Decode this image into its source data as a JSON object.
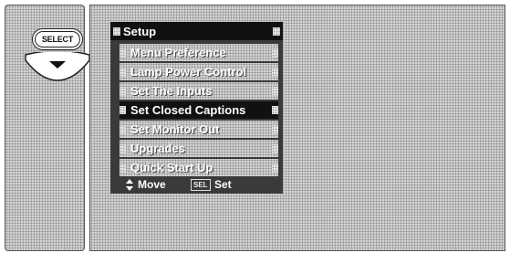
{
  "remote": {
    "select_label": "SELECT",
    "select_icon": "select-button-icon",
    "down_icon": "down-arrow-icon"
  },
  "menu": {
    "title": "Setup",
    "items": [
      {
        "label": "Menu Preference",
        "active": false
      },
      {
        "label": "Lamp Power Control",
        "active": false
      },
      {
        "label": "Set The Inputs",
        "active": false
      },
      {
        "label": "Set Closed Captions",
        "active": true
      },
      {
        "label": "Set Monitor Out",
        "active": false
      },
      {
        "label": "Upgrades",
        "active": false
      },
      {
        "label": "Quick Start Up",
        "active": false
      }
    ],
    "footer": {
      "move_label": "Move",
      "sel_key_label": "SEL",
      "set_label": "Set"
    }
  },
  "colors": {
    "menu_background": "#3a3a3a",
    "highlight": "#111111",
    "text": "#ffffff"
  }
}
